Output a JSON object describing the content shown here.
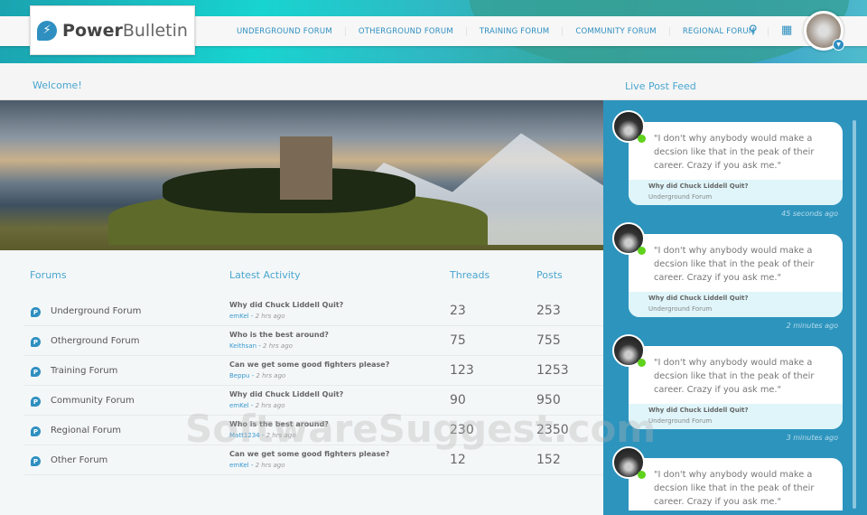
{
  "brand": {
    "name_bold": "Power",
    "name_light": "Bulletin"
  },
  "nav": [
    "UNDERGROUND FORUM",
    "OTHERGROUND FORUM",
    "TRAINING FORUM",
    "COMMUNITY FORUM",
    "REGIONAL FORUM"
  ],
  "icons": {
    "search": "search-icon",
    "calendar": "calendar-icon"
  },
  "welcome": "Welcome!",
  "feed_title": "Live Post Feed",
  "table": {
    "headers": [
      "Forums",
      "Latest Activity",
      "Threads",
      "Posts"
    ],
    "rows": [
      {
        "forum": "Underground Forum",
        "title": "Why did Chuck Liddell Quit?",
        "user": "emKel",
        "ago": "2 hrs ago",
        "threads": "23",
        "posts": "253"
      },
      {
        "forum": "Otherground Forum",
        "title": "Who is the best around?",
        "user": "Keithsan",
        "ago": "2 hrs ago",
        "threads": "75",
        "posts": "755"
      },
      {
        "forum": "Training Forum",
        "title": "Can we get some good fighters please?",
        "user": "Beppu",
        "ago": "2 hrs ago",
        "threads": "123",
        "posts": "1253"
      },
      {
        "forum": "Community Forum",
        "title": "Why did Chuck Liddell Quit?",
        "user": "emKel",
        "ago": "2 hrs ago",
        "threads": "90",
        "posts": "950"
      },
      {
        "forum": "Regional Forum",
        "title": "Who is the best around?",
        "user": "Matt1234",
        "ago": "2 hrs ago",
        "threads": "230",
        "posts": "2350"
      },
      {
        "forum": "Other Forum",
        "title": "Can we get some good fighters please?",
        "user": "emKel",
        "ago": "2 hrs ago",
        "threads": "12",
        "posts": "152"
      }
    ]
  },
  "feed": [
    {
      "quote": "\"I don't why anybody would make a decsion like that in the peak of their career. Crazy if you ask me.\"",
      "thread": "Why did Chuck Liddell Quit?",
      "forum": "Underground Forum",
      "time": "45 seconds ago"
    },
    {
      "quote": "\"I don't why anybody would make a decsion like that in the peak of their career. Crazy if you ask me.\"",
      "thread": "Why did Chuck Liddell Quit?",
      "forum": "Underground Forum",
      "time": "2 minutes ago"
    },
    {
      "quote": "\"I don't why anybody would make a decsion like that in the peak of their career. Crazy if you ask me.\"",
      "thread": "Why did Chuck Liddell Quit?",
      "forum": "Underground Forum",
      "time": "3 minutes ago"
    },
    {
      "quote": "\"I don't why anybody would make a decsion like that in the peak of their career. Crazy if you ask me.\"",
      "thread": "",
      "forum": "",
      "time": ""
    }
  ],
  "watermark": "SoftwareSuggest.com",
  "colors": {
    "accent": "#2e8fc0",
    "feed_bg": "#2d94bd",
    "online": "#5fd21c"
  }
}
